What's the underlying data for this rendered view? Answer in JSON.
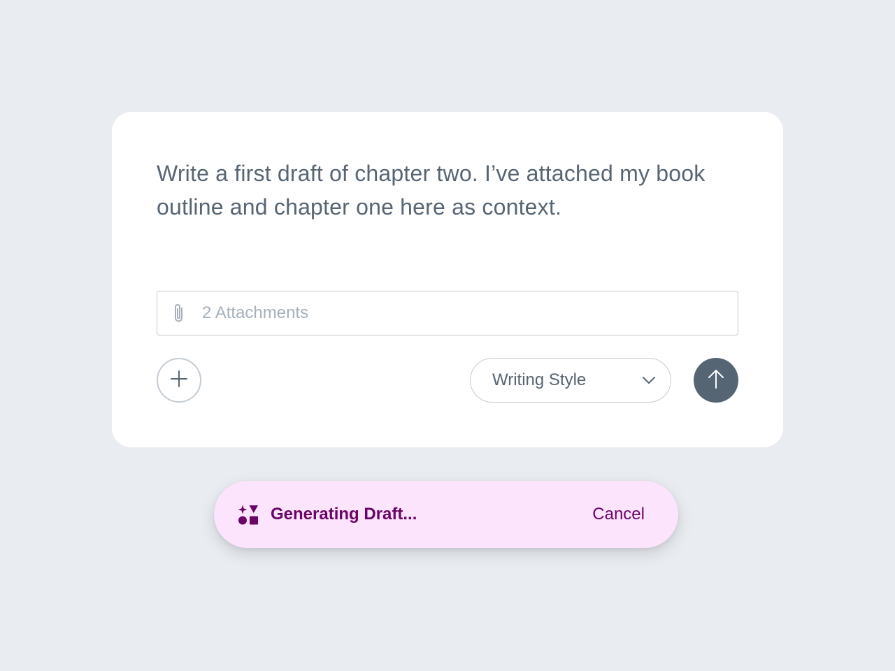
{
  "composer": {
    "prompt_text": "Write a first draft of chapter two. I’ve attached my book outline and chapter one here as context.",
    "attachments_label": "2 Attachments",
    "style_select_value": "Writing Style"
  },
  "status": {
    "label": "Generating Draft...",
    "cancel_label": "Cancel"
  },
  "icons": {
    "attachment": "paperclip-icon",
    "add": "plus-icon",
    "dropdown": "chevron-down-icon",
    "send": "arrow-up-icon",
    "generating": "shapes-icon"
  },
  "colors": {
    "background": "#e9ecf0",
    "card": "#ffffff",
    "text": "#576573",
    "placeholder": "#a6b0ba",
    "border": "#c4ccd4",
    "send_button": "#566573",
    "toast_background": "#fce4fc",
    "toast_text": "#6a0466"
  }
}
